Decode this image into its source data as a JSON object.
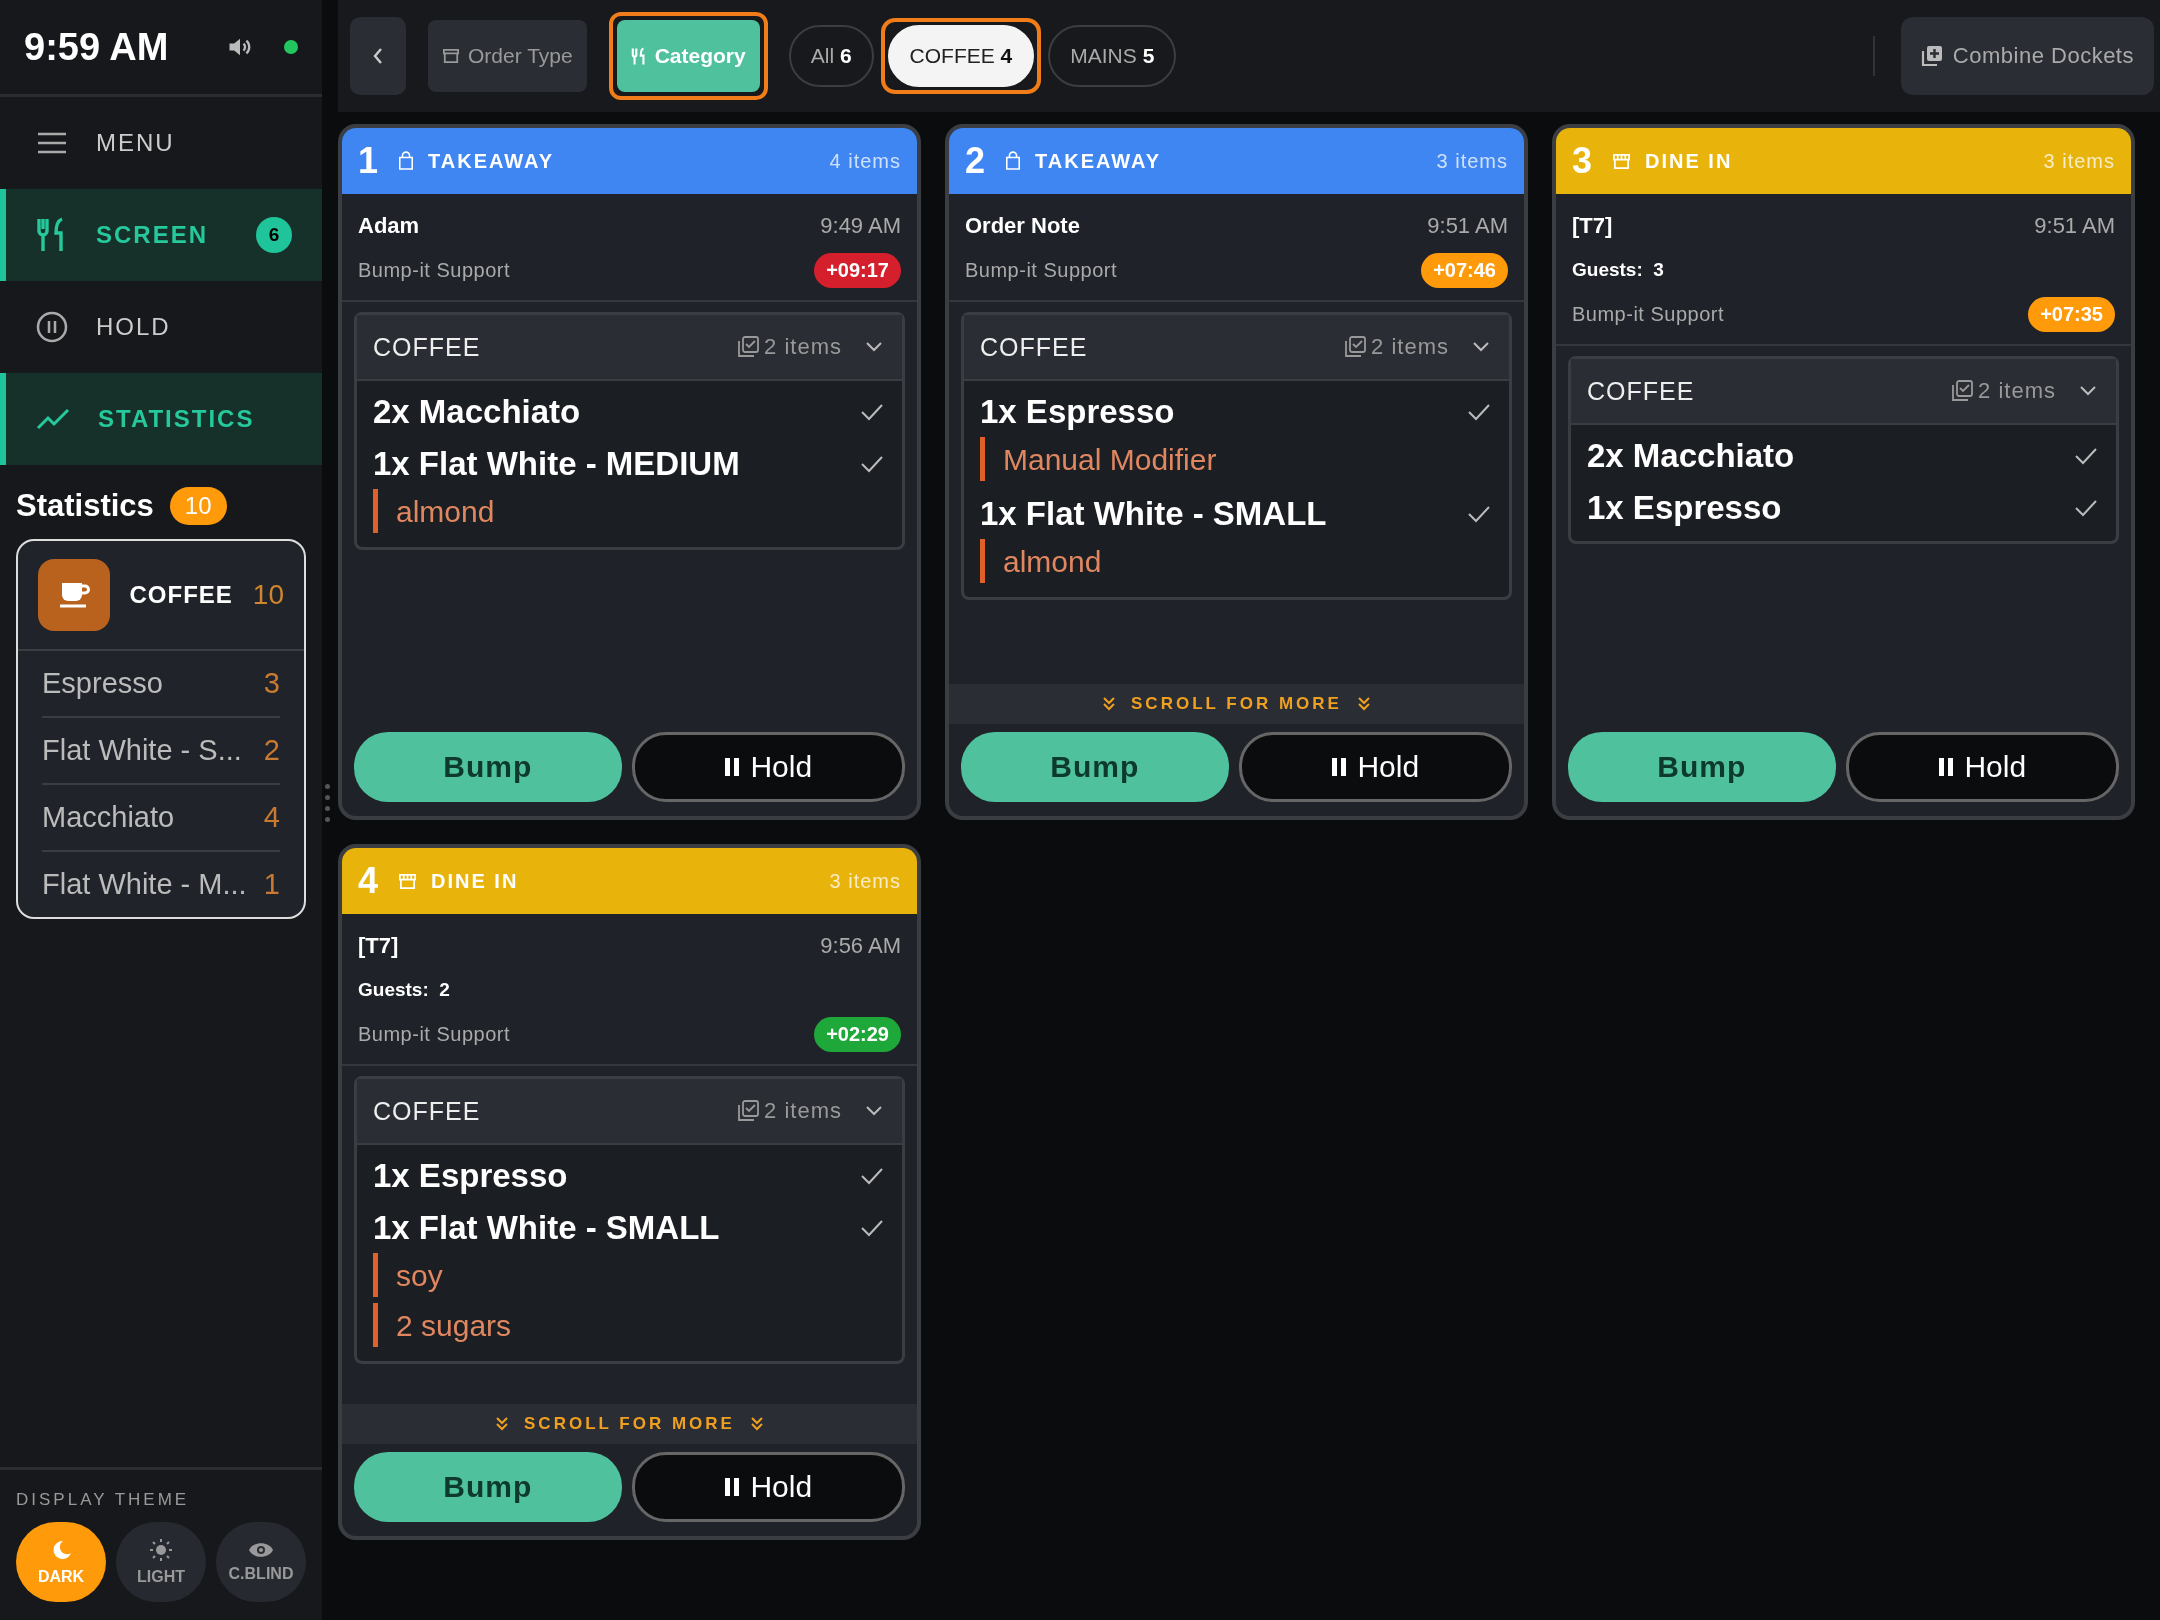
{
  "status": {
    "time": "9:59 AM",
    "online": true
  },
  "sidebar": {
    "nav": [
      {
        "kind": "menu",
        "label": "MENU",
        "selected": false
      },
      {
        "kind": "screen",
        "label": "SCREEN",
        "badge": "6",
        "selected": true
      },
      {
        "kind": "hold",
        "label": "HOLD",
        "selected": false
      },
      {
        "kind": "statistics",
        "label": "STATISTICS",
        "selected": true
      }
    ],
    "statistics": {
      "title": "Statistics",
      "count": "10",
      "group": {
        "name": "COFFEE",
        "count": "10",
        "items": [
          {
            "name": "Espresso",
            "count": "3"
          },
          {
            "name": "Flat White - S...",
            "count": "2"
          },
          {
            "name": "Macchiato",
            "count": "4"
          },
          {
            "name": "Flat White - M...",
            "count": "1"
          }
        ]
      }
    },
    "theme": {
      "title": "DISPLAY THEME",
      "options": [
        {
          "kind": "dark",
          "label": "DARK",
          "selected": true
        },
        {
          "kind": "light",
          "label": "LIGHT",
          "selected": false
        },
        {
          "kind": "cblind",
          "label": "C.BLIND",
          "selected": false
        }
      ]
    }
  },
  "toolbar": {
    "modes": [
      {
        "kind": "order-type",
        "label": "Order Type",
        "selected": false
      },
      {
        "kind": "category",
        "label": "Category",
        "selected": true
      }
    ],
    "categories": [
      {
        "label": "All",
        "count": "6",
        "selected": false
      },
      {
        "label": "COFFEE",
        "count": "4",
        "selected": true
      },
      {
        "label": "MAINS",
        "count": "5",
        "selected": false
      }
    ],
    "combine": "Combine Dockets"
  },
  "orders": [
    {
      "number": "1",
      "kind": "takeaway",
      "type": "TAKEAWAY",
      "items_count": "4 items",
      "name": "Adam",
      "time": "9:49 AM",
      "source": "Bump-it Support",
      "timer": {
        "text": "+09:17",
        "color": "#d61f2c"
      },
      "sections": [
        {
          "name": "COFFEE",
          "count": "2 items",
          "items": [
            {
              "name": "2x Macchiato",
              "checked": true
            },
            {
              "name": "1x Flat White - MEDIUM",
              "checked": true,
              "modifiers": [
                "almond"
              ]
            }
          ]
        }
      ],
      "bump": "Bump",
      "hold": "Hold"
    },
    {
      "number": "2",
      "kind": "takeaway",
      "type": "TAKEAWAY",
      "items_count": "3 items",
      "name": "Order Note",
      "time": "9:51 AM",
      "source": "Bump-it Support",
      "timer": {
        "text": "+07:46",
        "color": "#ff9a0a"
      },
      "sections": [
        {
          "name": "COFFEE",
          "count": "2 items",
          "items": [
            {
              "name": "1x Espresso",
              "checked": true,
              "modifiers": [
                "Manual Modifier"
              ]
            },
            {
              "name": "1x Flat White - SMALL",
              "checked": true,
              "modifiers": [
                "almond"
              ]
            }
          ]
        }
      ],
      "scroll_hint": "SCROLL FOR MORE",
      "bump": "Bump",
      "hold": "Hold"
    },
    {
      "number": "3",
      "kind": "dine-in",
      "type": "DINE IN",
      "items_count": "3 items",
      "name": "[T7]",
      "time": "9:51 AM",
      "guests": "Guests:  3",
      "source": "Bump-it Support",
      "timer": {
        "text": "+07:35",
        "color": "#ff9a0a"
      },
      "sections": [
        {
          "name": "COFFEE",
          "count": "2 items",
          "items": [
            {
              "name": "2x Macchiato",
              "checked": true
            },
            {
              "name": "1x Espresso",
              "checked": true
            }
          ]
        }
      ],
      "bump": "Bump",
      "hold": "Hold"
    },
    {
      "number": "4",
      "kind": "dine-in",
      "type": "DINE IN",
      "items_count": "3 items",
      "name": "[T7]",
      "time": "9:56 AM",
      "guests": "Guests:  2",
      "source": "Bump-it Support",
      "timer": {
        "text": "+02:29",
        "color": "#1fa83a"
      },
      "sections": [
        {
          "name": "COFFEE",
          "count": "2 items",
          "items": [
            {
              "name": "1x Espresso",
              "checked": true
            },
            {
              "name": "1x Flat White - SMALL",
              "checked": true,
              "modifiers": [
                "soy",
                "2 sugars"
              ]
            }
          ]
        }
      ],
      "scroll_hint": "SCROLL FOR MORE",
      "bump": "Bump",
      "hold": "Hold"
    }
  ]
}
